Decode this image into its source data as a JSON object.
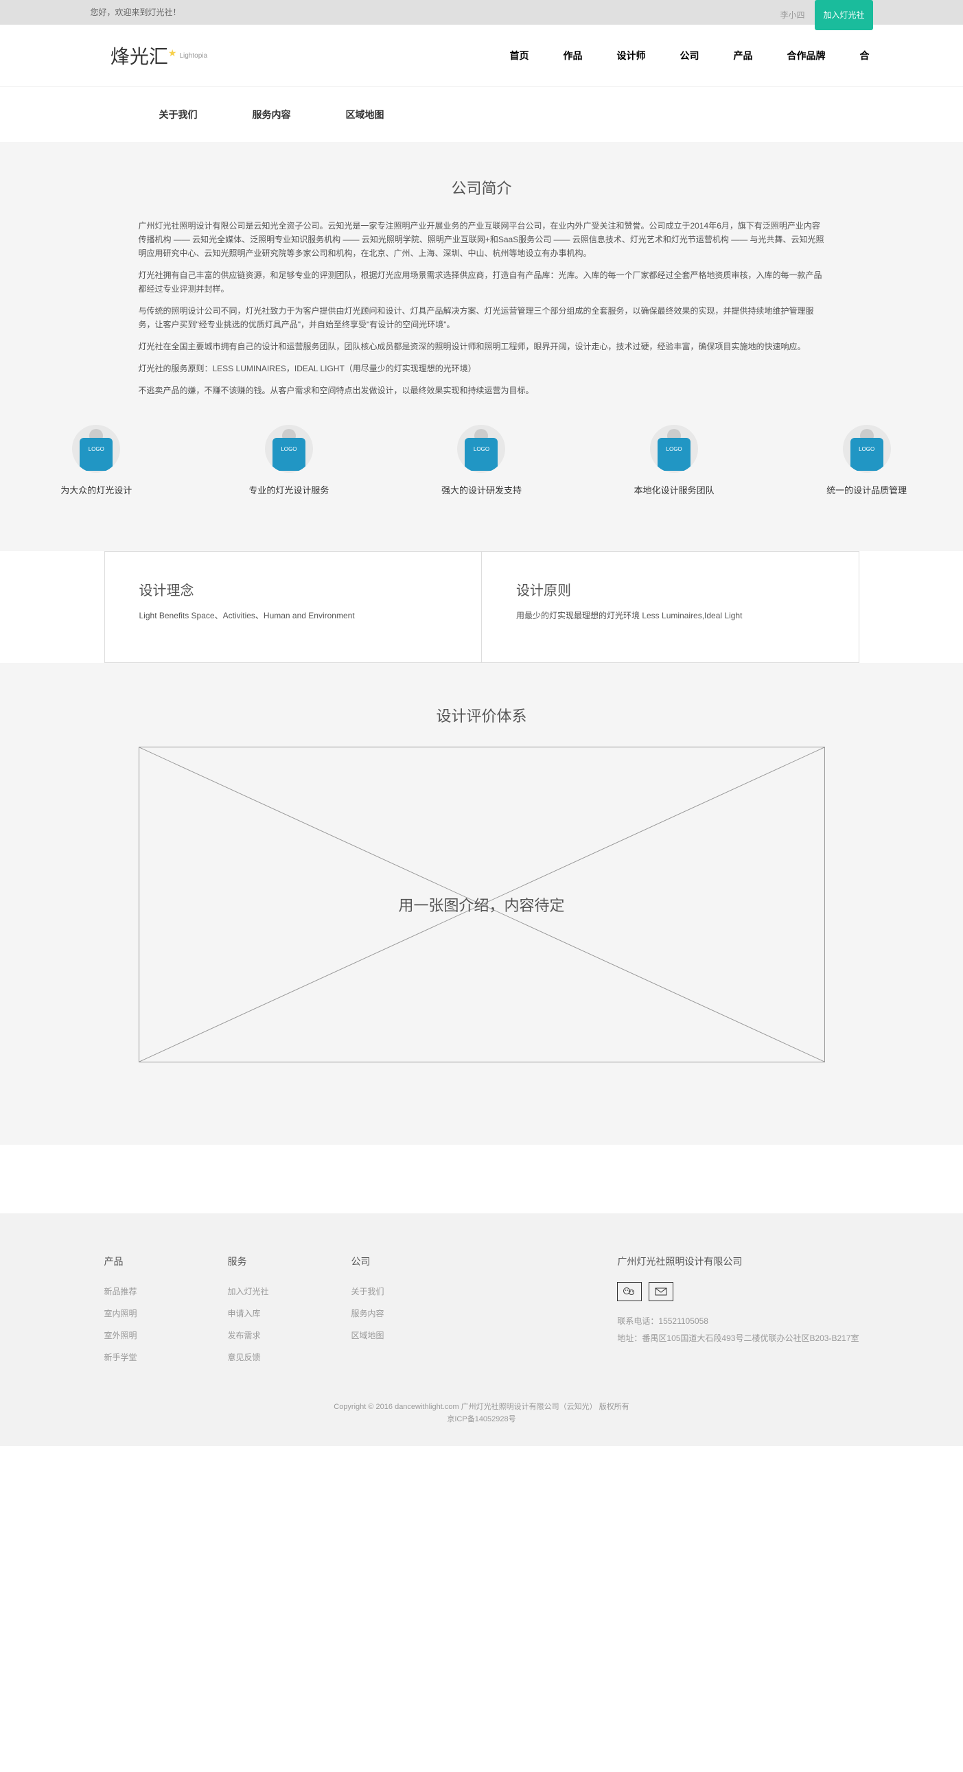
{
  "topbar": {
    "welcome": "您好，欢迎来到灯光社！",
    "user": "李小四",
    "join": "加入灯光社"
  },
  "logo": {
    "main": "烽光汇",
    "sub": "Lightopia"
  },
  "nav": [
    "首页",
    "作品",
    "设计师",
    "公司",
    "产品",
    "合作品牌",
    "合"
  ],
  "subnav": [
    "关于我们",
    "服务内容",
    "区域地图"
  ],
  "intro": {
    "title": "公司简介",
    "paragraphs": [
      "广州灯光社照明设计有限公司是云知光全资子公司。云知光是一家专注照明产业开展业务的产业互联网平台公司，在业内外广受关注和赞誉。公司成立于2014年6月，旗下有泛照明产业内容传播机构 —— 云知光全媒体、泛照明专业知识服务机构 —— 云知光照明学院、照明产业互联网+和SaaS服务公司 —— 云照信息技术、灯光艺术和灯光节运营机构 —— 与光共舞、云知光照明应用研究中心、云知光照明产业研究院等多家公司和机构，在北京、广州、上海、深圳、中山、杭州等地设立有办事机构。",
      "灯光社拥有自己丰富的供应链资源，和足够专业的评测团队，根据灯光应用场景需求选择供应商，打造自有产品库：光库。入库的每一个厂家都经过全套严格地资质审核，入库的每一款产品都经过专业评测并封样。",
      "与传统的照明设计公司不同，灯光社致力于为客户提供由灯光顾问和设计、灯具产品解决方案、灯光运营管理三个部分组成的全套服务，以确保最终效果的实现，并提供持续地维护管理服务，让客户买到\"经专业挑选的优质灯具产品\"，并自始至终享受\"有设计的空间光环境\"。",
      "灯光社在全国主要城市拥有自己的设计和运营服务团队，团队核心成员都是资深的照明设计师和照明工程师，眼界开阔，设计走心，技术过硬，经验丰富，确保项目实施地的快速响应。",
      "灯光社的服务原则：LESS LUMINAIRES，IDEAL LIGHT（用尽量少的灯实现理想的光环境）",
      "不逃卖产品的嫌，不赚不该赚的钱。从客户需求和空间特点出发做设计，以最终效果实现和持续运营为目标。"
    ]
  },
  "features": [
    {
      "icon": "LOGO",
      "text": "为大众的灯光设计"
    },
    {
      "icon": "LOGO",
      "text": "专业的灯光设计服务"
    },
    {
      "icon": "LOGO",
      "text": "强大的设计研发支持"
    },
    {
      "icon": "LOGO",
      "text": "本地化设计服务团队"
    },
    {
      "icon": "LOGO",
      "text": "统一的设计品质管理"
    }
  ],
  "concepts": [
    {
      "title": "设计理念",
      "desc": "Light Benefits Space、Activities、Human and Environment"
    },
    {
      "title": "设计原则",
      "desc": "用最少的灯实现最理想的灯光环境 Less Luminaires,Ideal Light"
    }
  ],
  "evaluation": {
    "title": "设计评价体系",
    "placeholder": "用一张图介绍，内容待定"
  },
  "footer": {
    "cols": [
      {
        "title": "产品",
        "links": [
          "新品推荐",
          "室内照明",
          "室外照明",
          "新手学堂"
        ]
      },
      {
        "title": "服务",
        "links": [
          "加入灯光社",
          "申请入库",
          "发布需求",
          "意见反馈"
        ]
      },
      {
        "title": "公司",
        "links": [
          "关于我们",
          "服务内容",
          "区域地图"
        ]
      }
    ],
    "company": "广州灯光社照明设计有限公司",
    "phone": "联系电话：15521105058",
    "address": "地址：番禺区105国道大石段493号二楼优联办公社区B203-B217室",
    "copyright1": "Copyright © 2016 dancewithlight.com 广州灯光社照明设计有限公司（云知光） 版权所有",
    "copyright2": "京ICP备14052928号"
  }
}
